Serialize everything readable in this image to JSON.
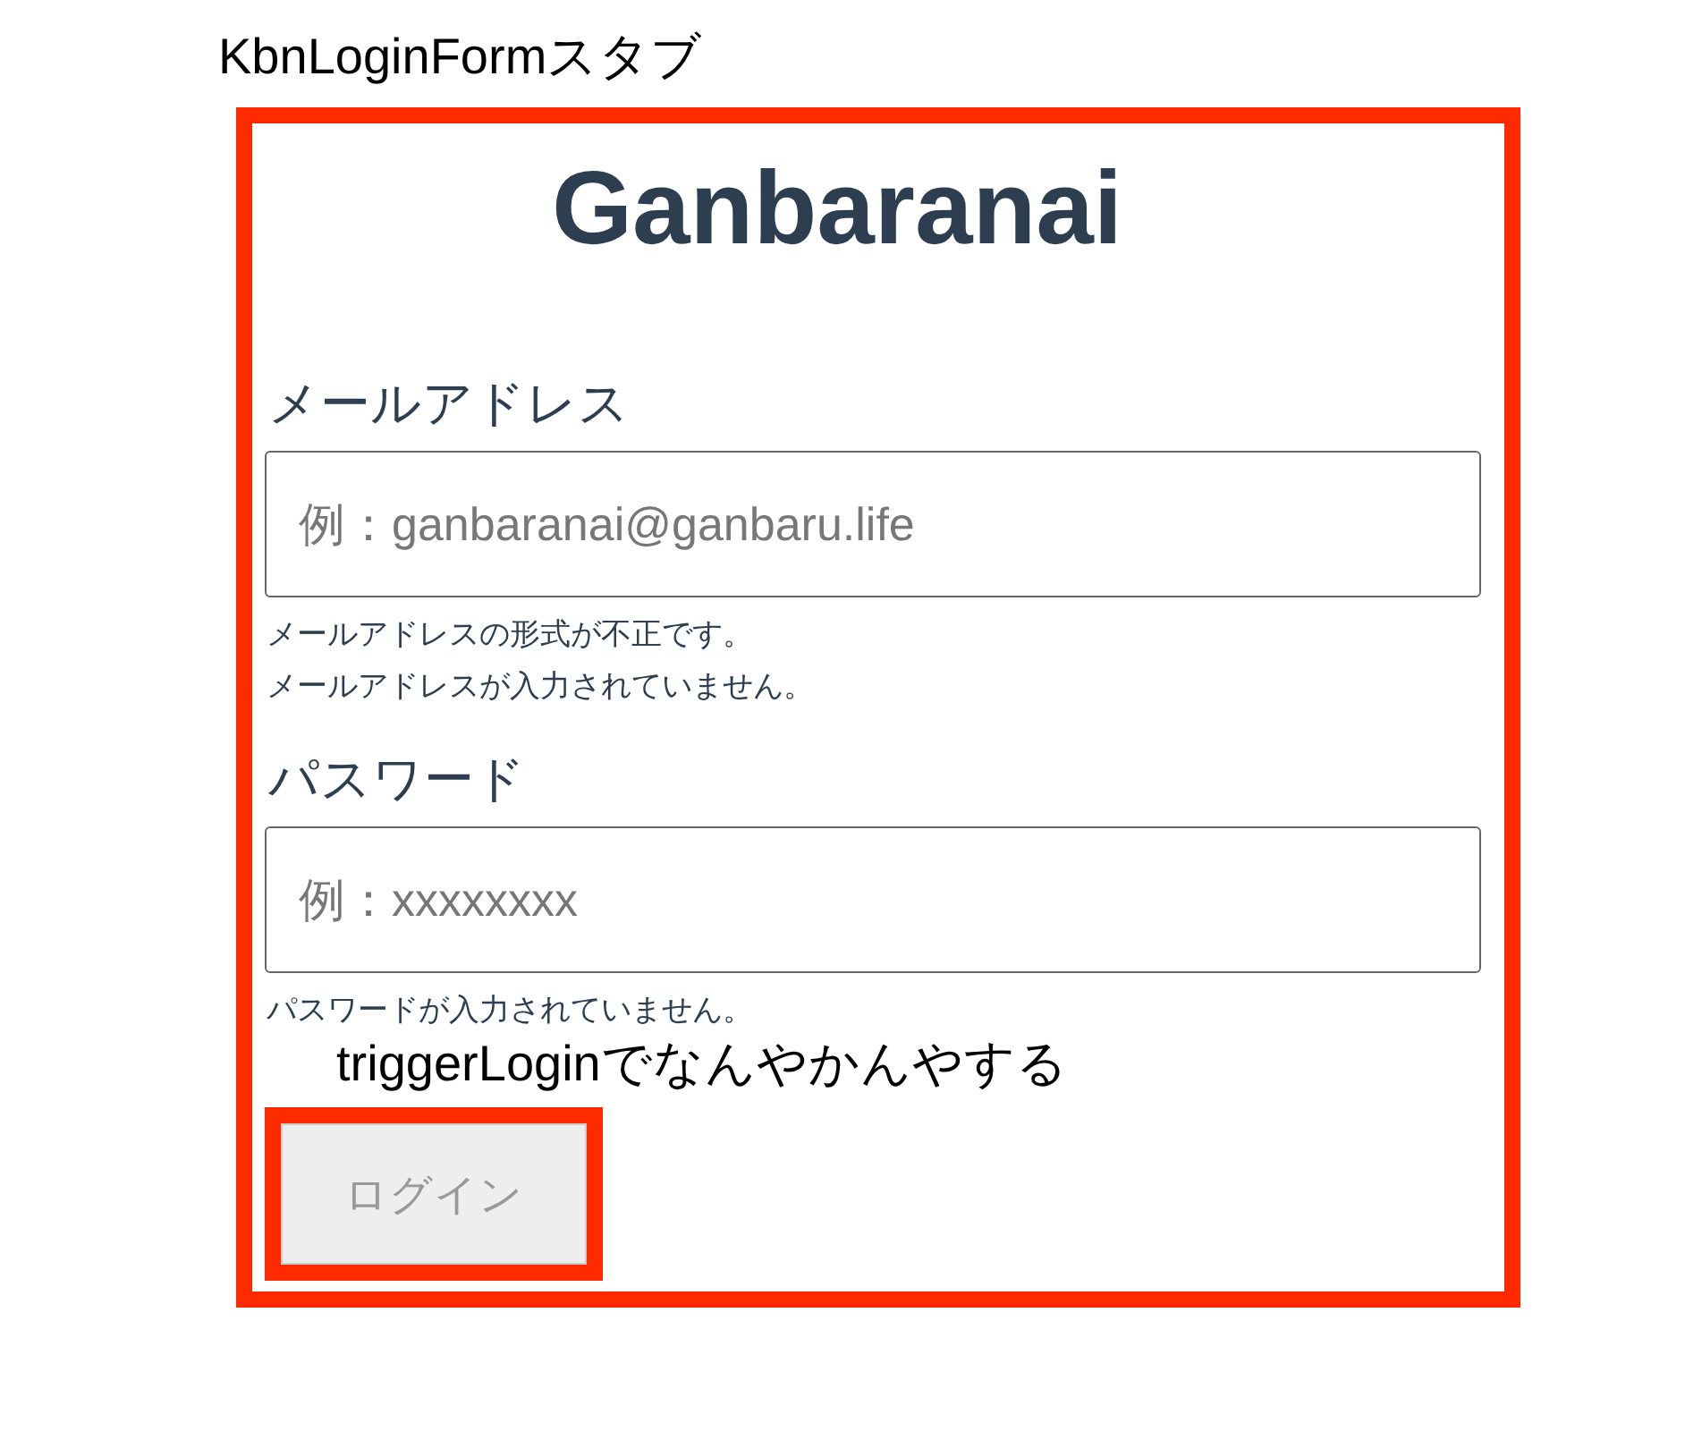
{
  "stub_title": "KbnLoginFormスタブ",
  "logo": "Ganbaranai",
  "fields": [
    {
      "label": "メールアドレス",
      "placeholder": "例：ganbaranai@ganbaru.life",
      "errors": [
        "メールアドレスの形式が不正です。",
        "メールアドレスが入力されていません。"
      ]
    },
    {
      "label": "パスワード",
      "placeholder": "例：xxxxxxxx",
      "errors": [
        "パスワードが入力されていません。"
      ]
    }
  ],
  "trigger_note": "triggerLoginでなんやかんやする",
  "login_button": {
    "label": "ログイン",
    "disabled": true
  }
}
